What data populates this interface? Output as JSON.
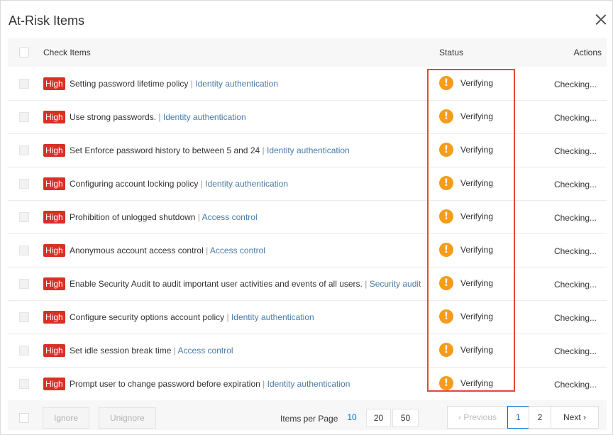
{
  "dialog": {
    "title": "At-Risk Items"
  },
  "table": {
    "headers": {
      "check_items": "Check Items",
      "status": "Status",
      "actions": "Actions"
    },
    "rows": [
      {
        "severity": "High",
        "name": "Setting password lifetime policy",
        "category": "Identity authentication",
        "status": "Verifying",
        "action": "Checking..."
      },
      {
        "severity": "High",
        "name": "Use strong passwords.",
        "category": "Identity authentication",
        "status": "Verifying",
        "action": "Checking..."
      },
      {
        "severity": "High",
        "name": "Set Enforce password history to between 5 and 24",
        "category": "Identity authentication",
        "status": "Verifying",
        "action": "Checking..."
      },
      {
        "severity": "High",
        "name": "Configuring account locking policy",
        "category": "Identity authentication",
        "status": "Verifying",
        "action": "Checking..."
      },
      {
        "severity": "High",
        "name": "Prohibition of unlogged shutdown",
        "category": "Access control",
        "status": "Verifying",
        "action": "Checking..."
      },
      {
        "severity": "High",
        "name": "Anonymous account access control",
        "category": "Access control",
        "status": "Verifying",
        "action": "Checking..."
      },
      {
        "severity": "High",
        "name": "Enable Security Audit to audit important user activities and events of all users.",
        "category": "Security audit",
        "status": "Verifying",
        "action": "Checking..."
      },
      {
        "severity": "High",
        "name": "Configure security options account policy",
        "category": "Identity authentication",
        "status": "Verifying",
        "action": "Checking..."
      },
      {
        "severity": "High",
        "name": "Set idle session break time",
        "category": "Access control",
        "status": "Verifying",
        "action": "Checking..."
      },
      {
        "severity": "High",
        "name": "Prompt user to change password before expiration",
        "category": "Identity authentication",
        "status": "Verifying",
        "action": "Checking..."
      }
    ],
    "separator": "|",
    "status_icon": "warning-icon",
    "severity_color": "#d93026",
    "warning_color": "#f59c19",
    "highlight_color": "#e04a3a"
  },
  "footer": {
    "ignore_label": "Ignore",
    "unignore_label": "Unignore",
    "items_per_page_label": "Items per Page",
    "page_sizes": [
      "10",
      "20",
      "50"
    ],
    "selected_page_size": "10",
    "previous_label": "Previous",
    "pages": [
      "1",
      "2"
    ],
    "current_page": "1",
    "next_label": "Next"
  }
}
